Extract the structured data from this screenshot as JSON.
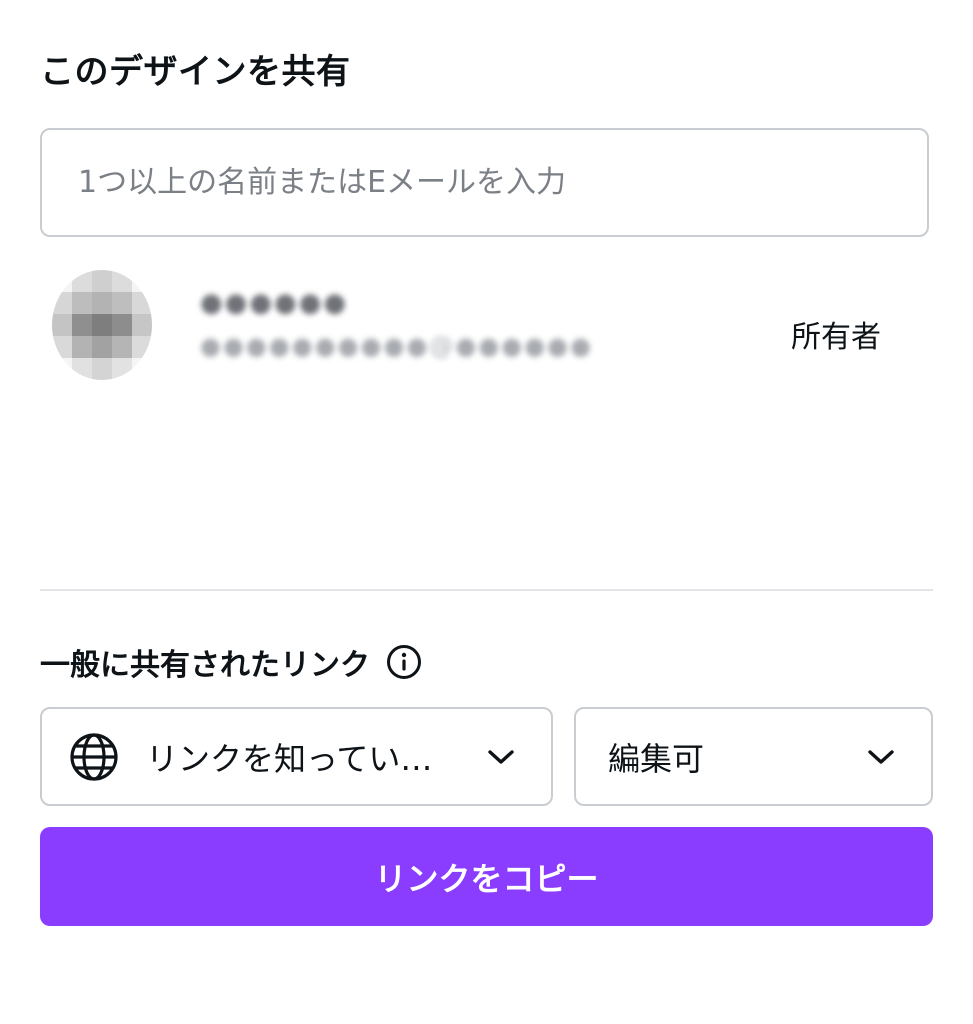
{
  "dialog": {
    "title": "このデザインを共有"
  },
  "invite": {
    "placeholder": "1つ以上の名前またはEメールを入力",
    "value": ""
  },
  "members": [
    {
      "name": "●●●●●●",
      "email": "●●●●●●●●●●@●●●●●●",
      "role": "所有者",
      "avatar_icon": "avatar-blurred"
    }
  ],
  "general_link": {
    "title": "一般に共有されたリンク",
    "info_icon": "info-icon",
    "access": {
      "icon": "globe-icon",
      "label": "リンクを知っている...",
      "chevron": "chevron-down-icon"
    },
    "permission": {
      "label": "編集可",
      "chevron": "chevron-down-icon"
    }
  },
  "actions": {
    "copy_link_label": "リンクをコピー"
  },
  "colors": {
    "primary": "#8b3dff",
    "text": "#0e1318",
    "placeholder": "#7b7f86",
    "border": "#c9ccd1",
    "divider": "#e3e5e8"
  }
}
